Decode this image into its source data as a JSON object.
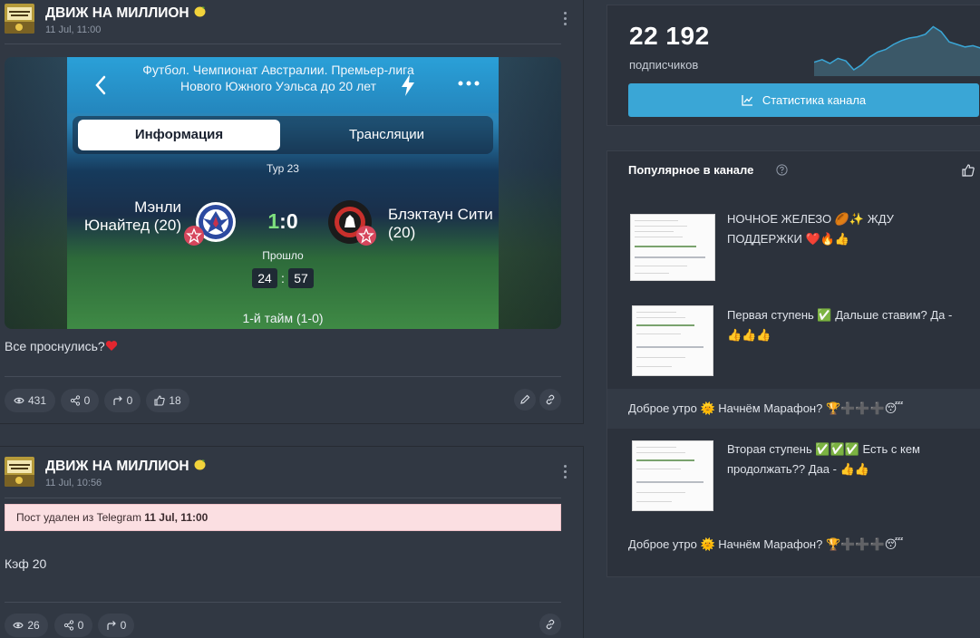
{
  "channel": {
    "name": "ДВИЖ НА МИЛЛИОН"
  },
  "posts": [
    {
      "date": "11 Jul, 11:00",
      "media": {
        "title": "Футбол. Чемпионат Австралии. Премьер-лига Нового Южного Уэльса до 20 лет",
        "tab_info": "Информация",
        "tab_streams": "Трансляции",
        "round": "Тур 23",
        "home_team": "Мэнли Юнайтед (20)",
        "away_team": "Блэктаун Сити (20)",
        "score_home": "1",
        "score_sep": ":",
        "score_away": "0",
        "status": "Прошло",
        "minutes": "24",
        "seconds": "57",
        "period": "1-й тайм (1-0)"
      },
      "text": "Все проснулись?",
      "views": "431",
      "shares": "0",
      "forwards": "0",
      "reactions": "18"
    },
    {
      "date": "11 Jul, 10:56",
      "deleted_prefix": "Пост удален из Telegram ",
      "deleted_date": "11 Jul, 11:00",
      "text": "Кэф 20",
      "views": "26",
      "shares": "0",
      "forwards": "0"
    }
  ],
  "stats": {
    "subscribers": "22 192",
    "subscribers_label": "подписчиков",
    "button_label": "Статистика канала",
    "trend": [
      0.78,
      0.74,
      0.8,
      0.72,
      0.76,
      0.9,
      0.82,
      0.7,
      0.62,
      0.58,
      0.5,
      0.44,
      0.4,
      0.38,
      0.34,
      0.22,
      0.3,
      0.46,
      0.5,
      0.54,
      0.52,
      0.56
    ]
  },
  "popular": {
    "title": "Популярное в канале",
    "items": [
      {
        "text": "НОЧНОЕ ЖЕЛЕЗО",
        "text2": "ЖДУ ПОДДЕРЖКИ"
      },
      {
        "text": "Первая ступень",
        "text2": "Дальше ставим? Да -"
      },
      {
        "text": "Доброе утро",
        "text2": "Начнём Марафон?"
      },
      {
        "text": "Вторая ступень",
        "text2": "Есть с кем продолжать?? Даа -"
      },
      {
        "text": "Доброе утро",
        "text2": "Начнём Марафон?"
      }
    ]
  },
  "colors": {
    "accent": "#3aa6d6",
    "background": "#313843",
    "panel": "#2c323c",
    "deleted_bg": "#fbdfe2"
  }
}
